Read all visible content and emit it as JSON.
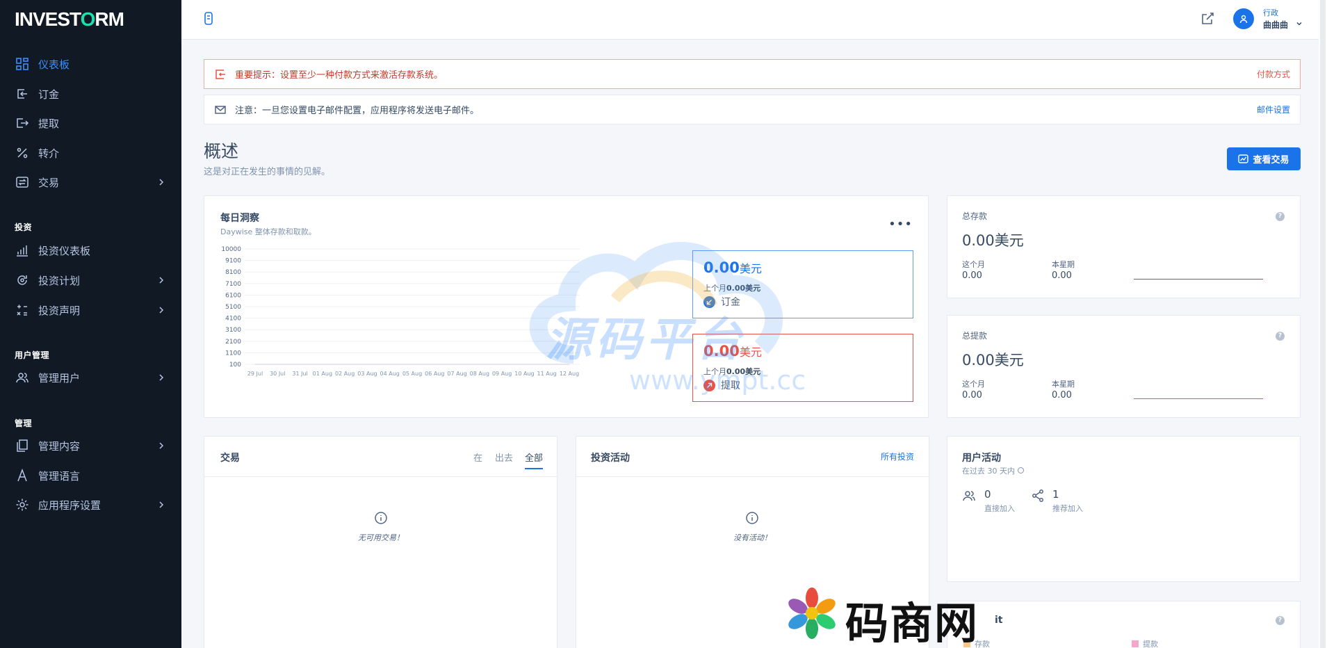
{
  "brand": {
    "logo_pre": "INVEST",
    "logo_o": "O",
    "logo_post": "RM"
  },
  "sidebar": {
    "items": [
      {
        "label": "仪表板",
        "icon": "dashboard-icon"
      },
      {
        "label": "订金",
        "icon": "deposit-icon"
      },
      {
        "label": "提取",
        "icon": "withdraw-icon"
      },
      {
        "label": "转介",
        "icon": "percent-icon"
      },
      {
        "label": "交易",
        "icon": "transfer-icon"
      },
      {
        "label": "投资仪表板",
        "icon": "bar-chart-icon"
      },
      {
        "label": "投资计划",
        "icon": "plan-icon"
      },
      {
        "label": "投资声明",
        "icon": "calc-icon"
      },
      {
        "label": "管理用户",
        "icon": "users-icon"
      },
      {
        "label": "管理内容",
        "icon": "content-icon"
      },
      {
        "label": "管理语言",
        "icon": "language-icon"
      },
      {
        "label": "应用程序设置",
        "icon": "settings-icon"
      }
    ],
    "sections": {
      "invest": "投资",
      "users": "用户管理",
      "manage": "管理"
    }
  },
  "header": {
    "role": "行政",
    "name": "曲曲曲"
  },
  "alerts": {
    "danger": {
      "text": "重要提示：设置至少一种付款方式来激活存款系统。",
      "link": "付款方式"
    },
    "info": {
      "text": "注意：一旦您设置电子邮件配置，应用程序将发送电子邮件。",
      "link": "邮件设置"
    }
  },
  "overview": {
    "title": "概述",
    "subtitle": "这是对正在发生的事情的见解。",
    "button": "查看交易"
  },
  "daily": {
    "title": "每日洞察",
    "subtitle": "Daywise 整体存款和取款。",
    "more": "•••",
    "deposit": {
      "value": "0.00",
      "unit": "美元",
      "prev_label": "上个月",
      "prev_value": "0.00美元",
      "kind": "订金"
    },
    "withdraw": {
      "value": "0.00",
      "unit": "美元",
      "prev_label": "上个月",
      "prev_value": "0.00美元",
      "kind": "提取"
    }
  },
  "chart_data": {
    "type": "line",
    "categories": [
      "29 Jul",
      "30 Jul",
      "31 Jul",
      "01 Aug",
      "02 Aug",
      "03 Aug",
      "04 Aug",
      "05 Aug",
      "06 Aug",
      "07 Aug",
      "08 Aug",
      "09 Aug",
      "10 Aug",
      "11 Aug",
      "12 Aug"
    ],
    "y_ticks": [
      10000,
      9100,
      8100,
      7100,
      6100,
      5100,
      4100,
      3100,
      2100,
      1100,
      100
    ],
    "series": [
      {
        "values": [
          0,
          0,
          0,
          0,
          0,
          0,
          0,
          0,
          0,
          0,
          0,
          0,
          0,
          0,
          0
        ],
        "color": "#1a73e8"
      },
      {
        "values": [
          0,
          0,
          0,
          0,
          0,
          0,
          0,
          0,
          0,
          0,
          0,
          0,
          0,
          0,
          0
        ],
        "color": "#e85347"
      }
    ],
    "ylim": [
      100,
      10000
    ],
    "grid": true
  },
  "total_deposit": {
    "label": "总存款",
    "value": "0.00美元",
    "month_label": "这个月",
    "month_value": "0.00",
    "week_label": "本星期",
    "week_value": "0.00"
  },
  "total_withdraw": {
    "label": "总提款",
    "value": "0.00美元",
    "month_label": "这个月",
    "month_value": "0.00",
    "week_label": "本星期",
    "week_value": "0.00"
  },
  "transactions": {
    "title": "交易",
    "tabs": [
      "在",
      "出去",
      "全部"
    ],
    "empty": "无可用交易！"
  },
  "investing": {
    "title": "投资活动",
    "link": "所有投资",
    "empty": "没有活动！"
  },
  "user_activity": {
    "title": "用户活动",
    "subtitle": "在过去 30 天内",
    "direct_value": "0",
    "direct_label": "直接加入",
    "ref_value": "1",
    "ref_label": "推荐加入"
  },
  "bottom_card": {
    "title_partial": "it",
    "legend_deposit": "存款",
    "legend_withdraw": "提款"
  },
  "watermarks": {
    "cloud_text": "源码平台",
    "cloud_url": "www.ympt.cc",
    "brand_text": "码商网"
  },
  "colors": {
    "primary": "#1a73e8",
    "danger": "#e85347",
    "sidebar": "#101924"
  }
}
